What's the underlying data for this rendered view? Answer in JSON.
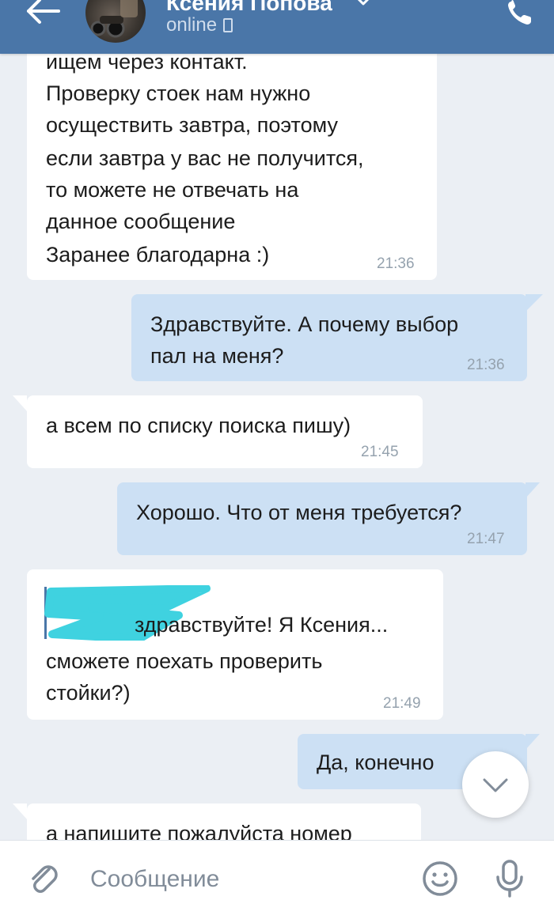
{
  "header": {
    "contact_name": "Ксения Попова",
    "status": "online"
  },
  "messages": [
    {
      "dir": "in",
      "lines": [
        "ищем через контакт.",
        "Проверку стоек нам нужно",
        "осуществить завтра, поэтому",
        "если завтра у вас не получится,",
        "то можете не отвечать на",
        "данное сообщение",
        "Заранее благодарна :)"
      ],
      "time": "21:36"
    },
    {
      "dir": "out",
      "lines": [
        "Здравствуйте. А почему выбор",
        "пал на меня?"
      ],
      "time": "21:36"
    },
    {
      "dir": "in",
      "lines": [
        "а всем по списку поиска пишу)"
      ],
      "time": "21:45"
    },
    {
      "dir": "out",
      "lines": [
        "Хорошо. Что от меня требуется?"
      ],
      "time": "21:47"
    },
    {
      "dir": "in",
      "lines": [
        "здравствуйте!  Я Ксения...",
        "сможете поехать проверить",
        "стойки?)"
      ],
      "time": "21:49"
    },
    {
      "dir": "out",
      "lines": [
        "Да, конечно"
      ],
      "time": ""
    },
    {
      "dir": "in",
      "lines": [
        "а напишите пожалуйста номер"
      ],
      "time": ""
    }
  ],
  "composer": {
    "placeholder": "Сообщение"
  },
  "colors": {
    "header": "#4a76a8",
    "background": "#ebeff4",
    "incoming_bubble": "#ffffff",
    "outgoing_bubble": "#cce0f4",
    "timestamp": "#95a2ae",
    "redaction": "#3fd2e0"
  },
  "icons": [
    "back-arrow-icon",
    "chevron-down-icon",
    "mobile-phone-icon",
    "phone-icon",
    "paperclip-icon",
    "smiley-icon",
    "microphone-icon",
    "scroll-down-chevron-icon"
  ]
}
